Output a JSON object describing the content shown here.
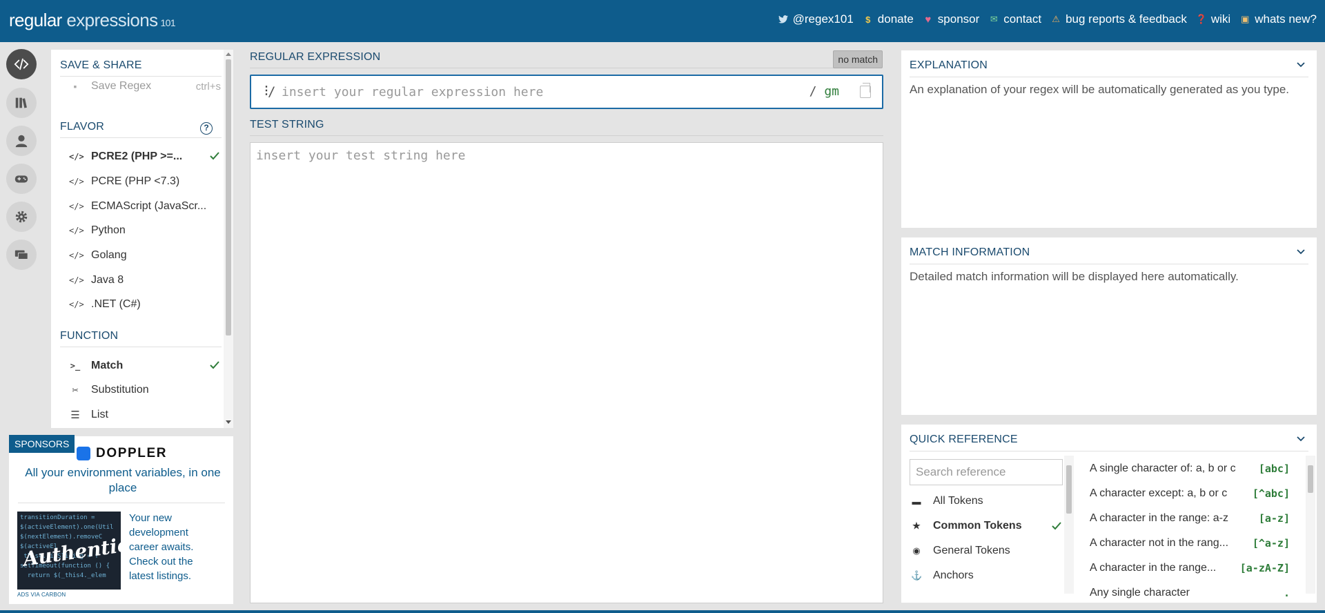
{
  "header": {
    "logo_main": "regular",
    "logo_exp": " expressions",
    "logo_ver": "101",
    "nav": [
      {
        "label": "@regex101",
        "icon": "twitter-icon",
        "glyph": "🐦"
      },
      {
        "label": "donate",
        "icon": "dollar-icon",
        "glyph": "$"
      },
      {
        "label": "sponsor",
        "icon": "heart-icon",
        "glyph": "♥"
      },
      {
        "label": "contact",
        "icon": "mail-icon",
        "glyph": "✉"
      },
      {
        "label": "bug reports & feedback",
        "icon": "warning-icon",
        "glyph": "⚠"
      },
      {
        "label": "wiki",
        "icon": "help-icon",
        "glyph": "?"
      },
      {
        "label": "whats new?",
        "icon": "news-icon",
        "glyph": "▣"
      }
    ]
  },
  "rail": {
    "icons": [
      "code-icon",
      "library-icon",
      "user-icon",
      "gamepad-icon",
      "settings-icon",
      "chat-icon"
    ]
  },
  "sidebar": {
    "save_share_title": "SAVE & SHARE",
    "save_label": "Save Regex",
    "save_shortcut": "ctrl+s",
    "flavor_title": "FLAVOR",
    "flavors": [
      {
        "label": "PCRE2 (PHP >=...",
        "selected": true
      },
      {
        "label": "PCRE (PHP <7.3)",
        "selected": false
      },
      {
        "label": "ECMAScript (JavaScr...",
        "selected": false
      },
      {
        "label": "Python",
        "selected": false
      },
      {
        "label": "Golang",
        "selected": false
      },
      {
        "label": "Java 8",
        "selected": false
      },
      {
        "label": ".NET (C#)",
        "selected": false
      }
    ],
    "function_title": "FUNCTION",
    "functions": [
      {
        "label": "Match",
        "icon": "terminal-icon",
        "glyph": ">_",
        "selected": true
      },
      {
        "label": "Substitution",
        "icon": "scissors-icon",
        "glyph": "✂",
        "selected": false
      },
      {
        "label": "List",
        "icon": "list-icon",
        "glyph": "☰",
        "selected": false
      }
    ]
  },
  "sponsors": {
    "tag": "SPONSORS",
    "brand": "DOPPLER",
    "tagline": "All your environment variables, in one place",
    "carbon_text": "Your new development career awaits. Check out the latest listings.",
    "carbon_image_text": "Authentic",
    "ads_via": "ADS VIA CARBON"
  },
  "editor": {
    "regex_title": "REGULAR EXPRESSION",
    "no_match": "no match",
    "regex_delim": "/",
    "regex_placeholder": "insert your regular expression here",
    "regex_value": "",
    "flags_slash": "/ ",
    "flags": "gm",
    "test_title": "TEST STRING",
    "test_placeholder": "insert your test string here",
    "test_value": ""
  },
  "explanation": {
    "title": "EXPLANATION",
    "body": "An explanation of your regex will be automatically generated as you type."
  },
  "match_info": {
    "title": "MATCH INFORMATION",
    "body": "Detailed match information will be displayed here automatically."
  },
  "quick_ref": {
    "title": "QUICK REFERENCE",
    "search_placeholder": "Search reference",
    "categories": [
      {
        "label": "All Tokens",
        "icon": "stack-icon",
        "glyph": "▬",
        "selected": false
      },
      {
        "label": "Common Tokens",
        "icon": "star-icon",
        "glyph": "★",
        "selected": true
      },
      {
        "label": "General Tokens",
        "icon": "target-icon",
        "glyph": "◉",
        "selected": false
      },
      {
        "label": "Anchors",
        "icon": "anchor-icon",
        "glyph": "⚓",
        "selected": false
      }
    ],
    "tokens": [
      {
        "desc": "A single character of: a, b or c",
        "token": "[abc]"
      },
      {
        "desc": "A character except: a, b or c",
        "token": "[^abc]"
      },
      {
        "desc": "A character in the range: a-z",
        "token": "[a-z]"
      },
      {
        "desc": "A character not in the rang...",
        "token": "[^a-z]"
      },
      {
        "desc": "A character in the range...",
        "token": "[a-zA-Z]"
      },
      {
        "desc": "Any single character",
        "token": "."
      }
    ]
  },
  "colors": {
    "header": "#0e5c8c",
    "accent_green": "#2f7d3a",
    "title_blue": "#1a4a6e"
  }
}
